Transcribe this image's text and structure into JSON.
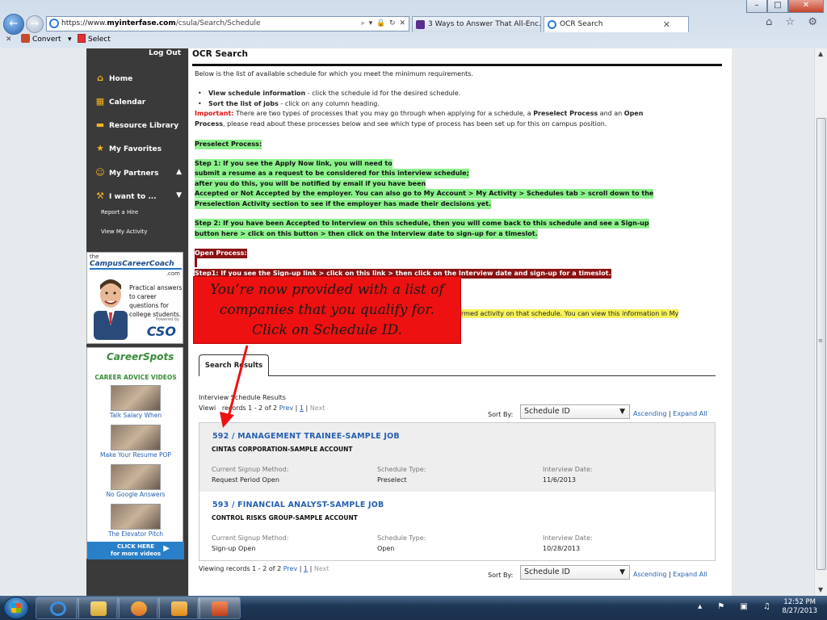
{
  "browser": {
    "window_buttons": [
      "–",
      "□",
      "✕"
    ],
    "nav": {
      "back": "←",
      "forward": "→"
    },
    "address": {
      "scheme": "https://www.",
      "host": "myinterfase.com",
      "path": "/csula/Search/Schedule",
      "tools": "⌕ ▾ 🔒 ↻ ✕"
    },
    "tabs": [
      {
        "label": "3 Ways to Answer That All-Enc...",
        "active": false
      },
      {
        "label": "OCR Search",
        "active": true,
        "close": "✕"
      }
    ],
    "right_icons": "⌂ ☆ ⚙",
    "command_bar": {
      "close": "✕",
      "convert": "Convert",
      "convert_caret": "▾",
      "select": "Select"
    }
  },
  "sidebar": {
    "logout": "Log Out",
    "items": [
      {
        "label": "Home",
        "icon": "⌂"
      },
      {
        "label": "Calendar",
        "icon": "▦"
      },
      {
        "label": "Resource Library",
        "icon": "▬"
      },
      {
        "label": "My Favorites",
        "icon": "★"
      },
      {
        "label": "My Partners",
        "icon": "☺",
        "caret": "▲"
      },
      {
        "label": "I want to ...",
        "icon": "⚒",
        "caret": "▼"
      }
    ],
    "subitems": [
      "Report a Hire",
      "View My Activity"
    ],
    "promo_cco": {
      "the": "the",
      "brand": "CampusCareerCoach",
      "dotcom": ".com",
      "copy": "Practical answers to career questions for college students.",
      "powered": "Powered by",
      "logo": "CSO"
    },
    "promo_careerspots": {
      "logo": "CareerSpots",
      "header": "CAREER ADVICE VIDEOS",
      "videos": [
        "Talk Salary When",
        "Make Your Resume POP",
        "No Google Answers",
        "The Elevator Pitch"
      ],
      "cta_line1": "CLICK HERE",
      "cta_line2": "for more videos",
      "cta_arrow": "▶"
    }
  },
  "content": {
    "title": "OCR Search",
    "intro": "Below is the list of available schedule for which you meet the minimum requirements.",
    "bullets": [
      {
        "bold": "View schedule information",
        "rest": " - click the schedule id for the desired schedule."
      },
      {
        "bold": "Sort the list of jobs",
        "rest": " - click on any column heading."
      }
    ],
    "important": {
      "label": "Important:",
      "line1_a": " There are two types of processes that you may go through when applying for a schedule, a ",
      "line1_b": "Preselect Process",
      "line1_c": " and an ",
      "line1_d": "Open",
      "line2_a": "Process",
      "line2_b": ", please read about these processes below and see which type of process has been set up for this on campus position."
    },
    "preselect": {
      "heading": "Preselect Process:",
      "step1": [
        "Step 1: If you see the Apply Now link, you will need to",
        "submit a resume as a request to be considered for this interview schedule;",
        "after you do this, you will be notified by email if you have been",
        "Accepted or Not Accepted by the employer. You can also go to My Account > My Activity > Schedules tab > scroll down to the",
        "Preselection Activity section to see if the employer has made their decisions yet."
      ],
      "step2": [
        "Step 2: If you have been Accepted to Interview on this schedule, then you will come back to this schedule and see a Sign-up",
        "button here > click on this button > then click on the Interview date to sign-up for a timeslot."
      ]
    },
    "open_process": {
      "heading": "Open Process:",
      "step1": "Step1: If you see the Sign-up link > click on this link > then click on the Interview date and sign-up for a timeslot.",
      "partial": "rmed activity on that schedule. You can view this information in My"
    },
    "callout": [
      "You’re now provided with a list of",
      "companies that you qualify for.",
      "Click on Schedule ID."
    ],
    "tab_label": "Search Results",
    "results_title": "Interview Schedule Results",
    "viewing": {
      "prefix": "Viewing records 1 - 2 of 2 ",
      "prev": "Prev",
      "sep1": " | ",
      "page": "1",
      "sep2": " | ",
      "next": "Next"
    },
    "viewing_top_prefix": "Viewi   records 1 - 2 of 2 ",
    "sort": {
      "label": "Sort By:",
      "value": "Schedule ID",
      "arrow": "🡓",
      "ascending": "Ascending",
      "sep": " | ",
      "expand": "Expand All"
    },
    "columns": [
      "Current Signup Method:",
      "Schedule Type:",
      "Interview Date:"
    ],
    "rows": [
      {
        "schedule": "592 / MANAGEMENT TRAINEE-SAMPLE JOB",
        "company": "CINTAS CORPORATION-SAMPLE ACCOUNT",
        "signup": "Request Period Open",
        "type": "Preselect",
        "date": "11/6/2013"
      },
      {
        "schedule": "593 / FINANCIAL ANALYST-SAMPLE JOB",
        "company": "CONTROL RISKS GROUP-SAMPLE ACCOUNT",
        "signup": "Sign-up Open",
        "type": "Open",
        "date": "10/28/2013"
      }
    ]
  },
  "taskbar": {
    "tray": "▴ ⚑ ▣ ♫",
    "time": "12:52 PM",
    "date": "8/27/2013"
  },
  "colors": {
    "accent_link": "#2660b0",
    "preselect_highlight": "#8cf28c",
    "open_highlight": "#8b1212",
    "callout": "#e11111",
    "sidebar_bg": "#3a3a3a"
  }
}
